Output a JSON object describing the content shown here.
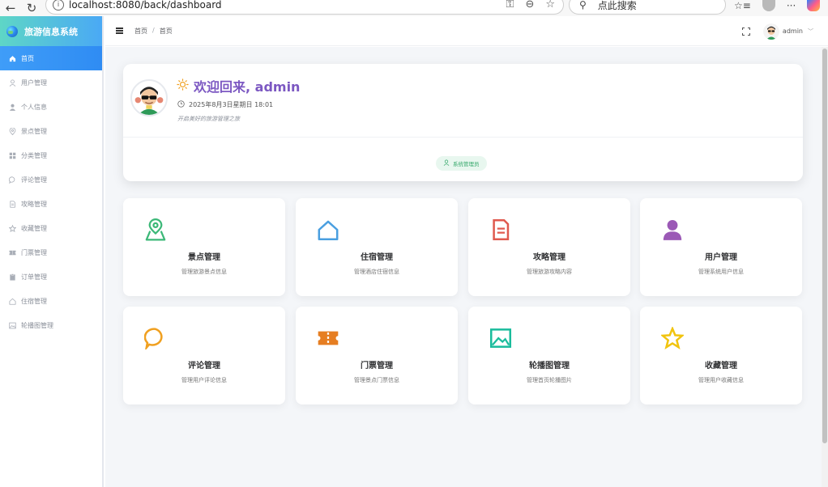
{
  "browser": {
    "url": "localhost:8080/back/dashboard",
    "search_placeholder": "点此搜索"
  },
  "sidebar": {
    "app_title": "旅游信息系统",
    "items": [
      {
        "label": "首页",
        "icon": "home-icon",
        "active": true
      },
      {
        "label": "用户管理",
        "icon": "user-outline-icon"
      },
      {
        "label": "个人信息",
        "icon": "user-filled-icon"
      },
      {
        "label": "景点管理",
        "icon": "location-icon"
      },
      {
        "label": "分类管理",
        "icon": "grid-icon"
      },
      {
        "label": "评论管理",
        "icon": "chat-icon"
      },
      {
        "label": "攻略管理",
        "icon": "document-icon"
      },
      {
        "label": "收藏管理",
        "icon": "star-icon"
      },
      {
        "label": "门票管理",
        "icon": "ticket-icon"
      },
      {
        "label": "订单管理",
        "icon": "clipboard-icon"
      },
      {
        "label": "住宿管理",
        "icon": "house-icon"
      },
      {
        "label": "轮播图管理",
        "icon": "picture-icon"
      }
    ]
  },
  "header": {
    "breadcrumb": [
      "首页",
      "首页"
    ],
    "breadcrumb_sep": "/",
    "username": "admin"
  },
  "welcome": {
    "greeting": "欢迎回来, admin",
    "datetime": "2025年8月3日星期日 18:01",
    "subtitle": "开启美好的旅游管理之旅",
    "role": "系统管理员"
  },
  "features": [
    {
      "title": "景点管理",
      "desc": "管理旅游景点信息",
      "icon": "map-pin-icon",
      "color": "#3cb878"
    },
    {
      "title": "住宿管理",
      "desc": "管理酒店住宿信息",
      "icon": "house-icon",
      "color": "#4a9fe0"
    },
    {
      "title": "攻略管理",
      "desc": "管理旅游攻略内容",
      "icon": "document-icon",
      "color": "#e05a4f"
    },
    {
      "title": "用户管理",
      "desc": "管理系统用户信息",
      "icon": "user-icon",
      "color": "#9b59b6"
    },
    {
      "title": "评论管理",
      "desc": "管理用户评论信息",
      "icon": "chat-icon",
      "color": "#f0a020"
    },
    {
      "title": "门票管理",
      "desc": "管理景点门票信息",
      "icon": "ticket-icon",
      "color": "#e67e22"
    },
    {
      "title": "轮播图管理",
      "desc": "管理首页轮播图片",
      "icon": "picture-icon",
      "color": "#1abc9c"
    },
    {
      "title": "收藏管理",
      "desc": "管理用户收藏信息",
      "icon": "star-icon",
      "color": "#f1c40f"
    }
  ]
}
